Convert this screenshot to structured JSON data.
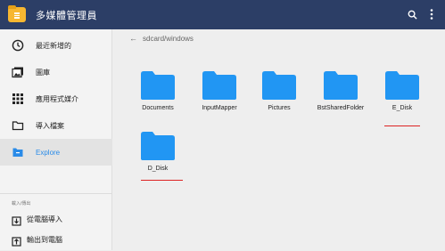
{
  "app": {
    "title": "多媒體管理員"
  },
  "header": {
    "search_icon": "search-icon",
    "menu_icon": "more-vert-icon"
  },
  "sidebar": {
    "items": [
      {
        "label": "最近新增的",
        "icon": "clock-icon"
      },
      {
        "label": "圖庫",
        "icon": "gallery-icon"
      },
      {
        "label": "應用程式媒介",
        "icon": "apps-grid-icon"
      },
      {
        "label": "導入檔案",
        "icon": "folder-outline-icon"
      },
      {
        "label": "Explore",
        "icon": "explore-folder-icon",
        "active": true
      }
    ],
    "section_label": "載入/傳出",
    "bottom_items": [
      {
        "label": "從電腦導入",
        "icon": "import-icon"
      },
      {
        "label": "輸出到電腦",
        "icon": "export-icon"
      }
    ]
  },
  "main": {
    "breadcrumb": "sdcard/windows",
    "folders": [
      {
        "name": "Documents"
      },
      {
        "name": "InputMapper"
      },
      {
        "name": "Pictures"
      },
      {
        "name": "BstSharedFolder"
      },
      {
        "name": "E_Disk"
      },
      {
        "name": "D_Disk"
      }
    ]
  },
  "colors": {
    "topbar": "#2c3e66",
    "folder": "#2196f3",
    "accent": "#2a8be8",
    "underline": "#d22222"
  }
}
